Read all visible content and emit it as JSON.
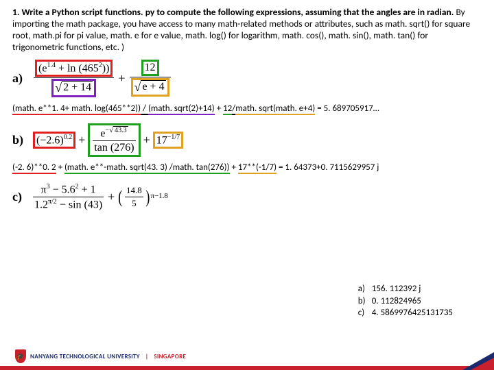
{
  "intro": {
    "bold_part": "1. Write a Python script functions. py to compute the following expressions, assuming that the angles are in radian.",
    "rest": " By importing the math package, you have access to many math-related methods or attributes, such as math. sqrt() for square root, math.pi for pi value, math. e for e value, math. log() for logarithm, math. cos(), math. sin(), math. tan() for trigonometric functions, etc. )"
  },
  "eq_a": {
    "label": "a)",
    "num1": "(e",
    "num1_sup": "1.4",
    "num1_rest": " + ln (465",
    "num1_sup2": "2",
    "num1_close": "))",
    "den1_root": "2 + 14",
    "num2": "12",
    "den2_root": "e + 4",
    "plus": "+"
  },
  "ans_a": {
    "p1": "(math. e**1. 4+ math. log(465**2))",
    "slash": " / ",
    "p2": "(math. sqrt(2)+14)",
    "plus": " + ",
    "p3": "12",
    "slash2": "/",
    "p4": "math. sqrt(math. e+4)",
    "eq": " = 5. 689705917…"
  },
  "eq_b": {
    "label": "b)",
    "t1": "(−2.6)",
    "t1_sup": "0.2",
    "plus": "+",
    "num": "e",
    "num_sup_pre": "−",
    "num_sup_root": "43.3",
    "den": "tan (276)",
    "t3": "17",
    "t3_sup": "−1/7"
  },
  "ans_b": {
    "p1": "(-2. 6)**0. 2",
    "plus": " + ",
    "p2": "(math. e**-math. sqrt(43. 3) /math. tan(276))",
    "plus2": " + ",
    "p3": "17**(-1/7)",
    "eq": " = 1. 64373+0. 7115629957 j"
  },
  "eq_c": {
    "label": "c)",
    "num1a": "π",
    "num1a_sup": "3",
    "num1b": " − 5.6",
    "num1b_sup": "2",
    "num1c": " + 1",
    "den1a": "1.2",
    "den1a_sup": "π/2",
    "den1b": " − sin (43)",
    "plus": "+",
    "num2": "14.8",
    "den2": "5",
    "outer_sup": "π−1.8"
  },
  "answers": {
    "a_let": "a)",
    "a_val": "156. 112392 j",
    "b_let": "b)",
    "b_val": "0. 112824965",
    "c_let": "c)",
    "c_val": "4. 5869976425131735"
  },
  "footer": {
    "uni": "NANYANG TECHNOLOGICAL UNIVERSITY",
    "sg": "SINGAPORE"
  }
}
